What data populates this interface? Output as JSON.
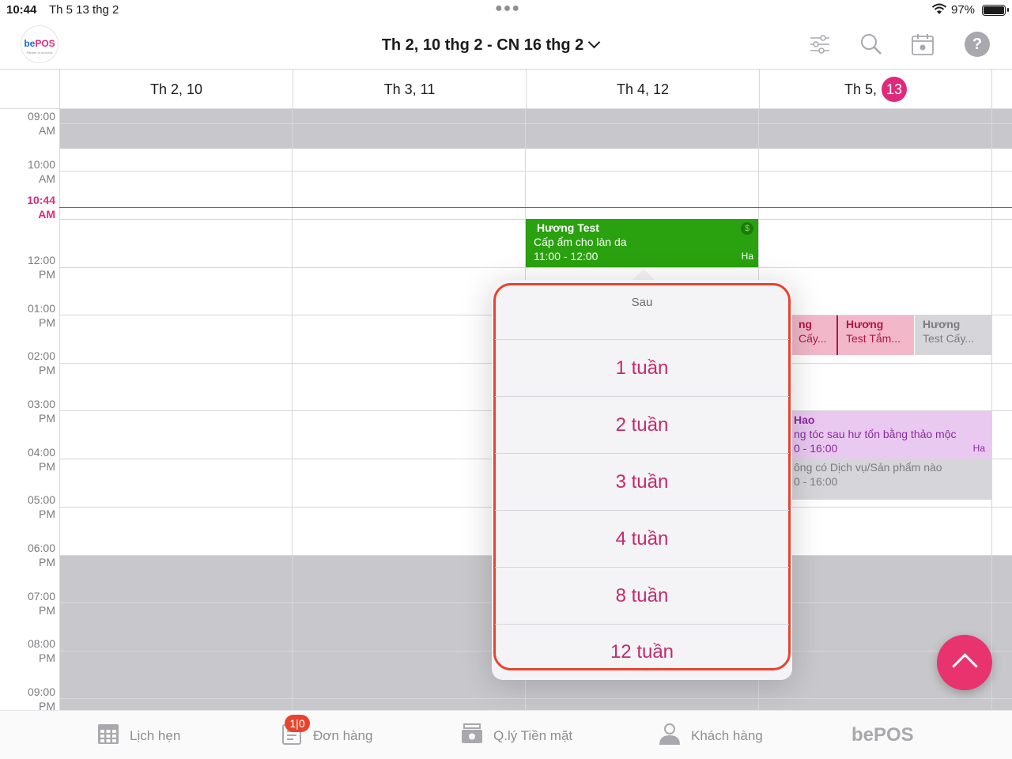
{
  "status_bar": {
    "time": "10:44",
    "date": "Th 5 13 thg 2",
    "battery": "97%"
  },
  "header": {
    "logo_text": "bePOS",
    "logo_tagline": "Partner of success",
    "week_range": "Th 2, 10 thg 2 - CN 16 thg 2"
  },
  "days": [
    {
      "label": "Th 2, 10",
      "badge": ""
    },
    {
      "label": "Th 3, 11",
      "badge": ""
    },
    {
      "label": "Th 4, 12",
      "badge": ""
    },
    {
      "label": "Th 5,",
      "badge": "13"
    }
  ],
  "time_labels": [
    {
      "time": "09:00",
      "ampm": "AM"
    },
    {
      "time": "10:00",
      "ampm": "AM"
    },
    {
      "time": "10:44",
      "ampm": "AM"
    },
    {
      "time": "12:00",
      "ampm": "PM"
    },
    {
      "time": "01:00",
      "ampm": "PM"
    },
    {
      "time": "02:00",
      "ampm": "PM"
    },
    {
      "time": "03:00",
      "ampm": "PM"
    },
    {
      "time": "04:00",
      "ampm": "PM"
    },
    {
      "time": "05:00",
      "ampm": "PM"
    },
    {
      "time": "06:00",
      "ampm": "PM"
    },
    {
      "time": "07:00",
      "ampm": "PM"
    },
    {
      "time": "08:00",
      "ampm": "PM"
    },
    {
      "time": "09:00",
      "ampm": "PM"
    }
  ],
  "events": {
    "green": {
      "name": "Hương Test",
      "service": "Cấp ẩm cho làn da",
      "time": "11:00 - 12:00",
      "staff": "Ha"
    },
    "pink_a": {
      "name": "ng",
      "service": "Cấy..."
    },
    "pink_b": {
      "name": "Hương",
      "service": "Test  Tắm..."
    },
    "gray_a": {
      "name": "Hương",
      "service": "Test  Cấy..."
    },
    "purple": {
      "name": "Hao",
      "service": "ng tóc sau hư tổn bằng thảo mộc",
      "time": "0 - 16:00",
      "staff": "Ha"
    },
    "gray_b": {
      "service": "ông có Dịch vụ/Sản phẩm nào",
      "time": "0 - 16:00"
    }
  },
  "popover": {
    "title": "Sau",
    "options": [
      "1 tuần",
      "2 tuần",
      "3 tuần",
      "4 tuần",
      "8 tuần",
      "12 tuần"
    ]
  },
  "tabbar": {
    "appointments": "Lịch hẹn",
    "orders": "Đơn hàng",
    "orders_badge": "1|0",
    "cash": "Q.lý Tiền mặt",
    "customers": "Khách hàng",
    "brand": "bePOS"
  },
  "colors": {
    "accent": "#e0297a",
    "event_green": "#2aa10f",
    "highlight_border": "#e8432e"
  }
}
